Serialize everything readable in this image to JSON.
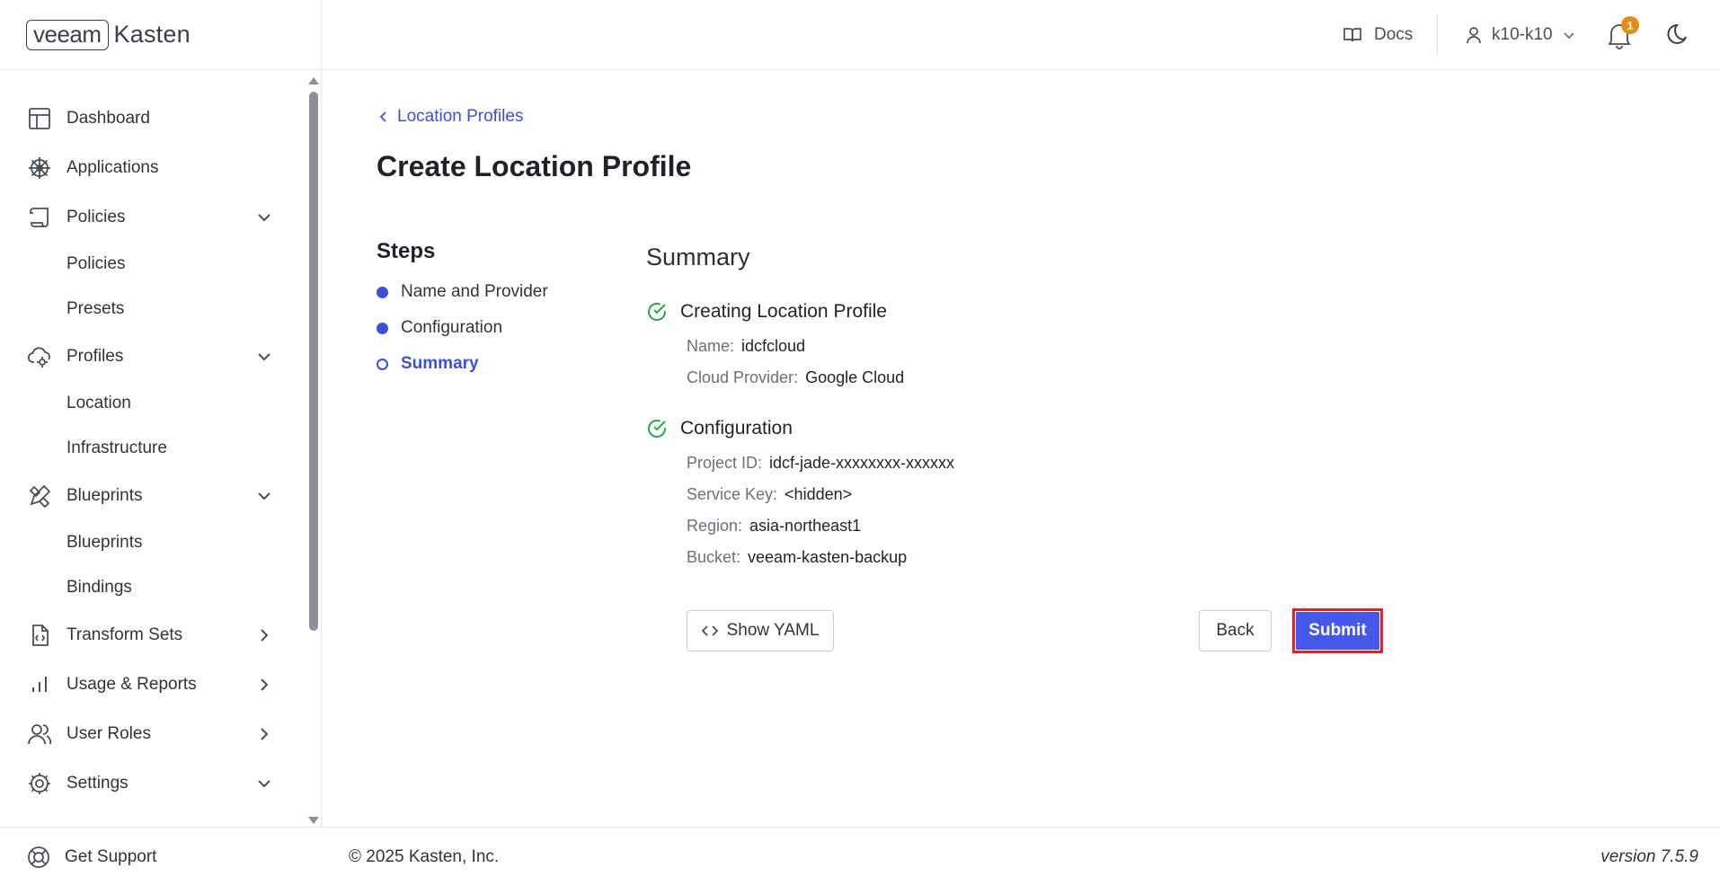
{
  "brand": {
    "veeam": "veeam",
    "kasten": "Kasten"
  },
  "header": {
    "docs_label": "Docs",
    "user_label": "k10-k10",
    "notification_count": "1"
  },
  "sidebar": {
    "items": [
      {
        "label": "Dashboard",
        "icon": "dashboard-icon"
      },
      {
        "label": "Applications",
        "icon": "helm-wheel-icon"
      },
      {
        "label": "Policies",
        "icon": "scroll-icon",
        "expanded": true,
        "children": [
          "Policies",
          "Presets"
        ]
      },
      {
        "label": "Profiles",
        "icon": "cloud-gear-icon",
        "expanded": true,
        "children": [
          "Location",
          "Infrastructure"
        ]
      },
      {
        "label": "Blueprints",
        "icon": "pencil-ruler-icon",
        "expanded": true,
        "children": [
          "Blueprints",
          "Bindings"
        ]
      },
      {
        "label": "Transform Sets",
        "icon": "file-code-icon",
        "expanded": false
      },
      {
        "label": "Usage & Reports",
        "icon": "bar-chart-icon",
        "expanded": false
      },
      {
        "label": "User Roles",
        "icon": "users-icon",
        "expanded": false
      },
      {
        "label": "Settings",
        "icon": "gear-icon",
        "expanded": true
      }
    ],
    "support_label": "Get Support"
  },
  "main": {
    "breadcrumb": "Location Profiles",
    "page_title": "Create Location Profile",
    "steps_title": "Steps",
    "steps": [
      {
        "label": "Name and Provider",
        "state": "done"
      },
      {
        "label": "Configuration",
        "state": "done"
      },
      {
        "label": "Summary",
        "state": "current"
      }
    ],
    "summary_title": "Summary",
    "sections": [
      {
        "title": "Creating Location Profile",
        "fields": [
          {
            "key": "Name:",
            "value": "idcfcloud"
          },
          {
            "key": "Cloud Provider:",
            "value": "Google Cloud"
          }
        ]
      },
      {
        "title": "Configuration",
        "fields": [
          {
            "key": "Project ID:",
            "value": "idcf-jade-xxxxxxxx-xxxxxx"
          },
          {
            "key": "Service Key:",
            "value": "<hidden>"
          },
          {
            "key": "Region:",
            "value": "asia-northeast1"
          },
          {
            "key": "Bucket:",
            "value": "veeam-kasten-backup"
          }
        ]
      }
    ],
    "buttons": {
      "show_yaml": "Show YAML",
      "back": "Back",
      "submit": "Submit"
    }
  },
  "footer": {
    "copyright": "© 2025 Kasten, Inc.",
    "version": "version 7.5.9"
  },
  "colors": {
    "accent": "#4657ec",
    "link": "#3c4fd8",
    "success": "#22a845",
    "badge": "#e88a14",
    "highlight": "#e2222b"
  }
}
